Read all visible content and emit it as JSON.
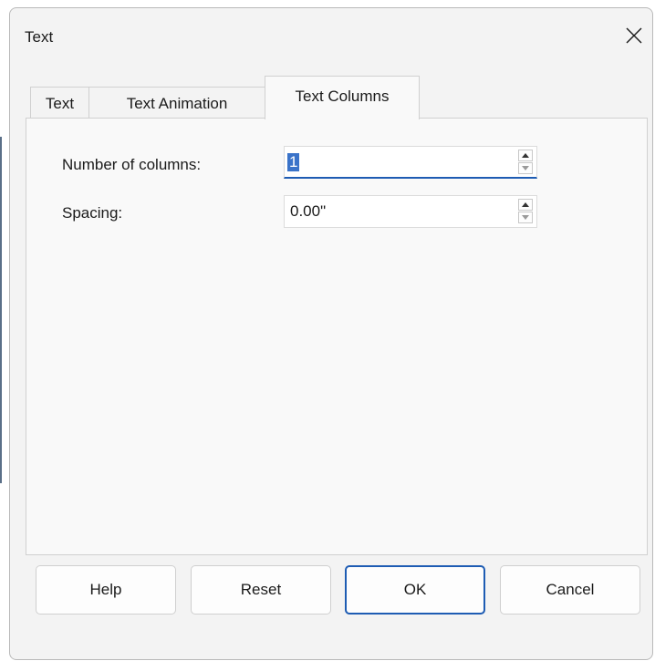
{
  "dialog": {
    "title": "Text"
  },
  "tabs": [
    {
      "label": "Text"
    },
    {
      "label": "Text Animation"
    },
    {
      "label": "Text Columns"
    }
  ],
  "fields": {
    "columns": {
      "label": "Number of columns:",
      "value": "1"
    },
    "spacing": {
      "label": "Spacing:",
      "value": "0.00\""
    }
  },
  "buttons": {
    "help": "Help",
    "reset": "Reset",
    "ok": "OK",
    "cancel": "Cancel"
  },
  "colors": {
    "accent": "#1e5cb3",
    "selection": "#3a73c9",
    "dialog_bg": "#f3f3f3"
  }
}
